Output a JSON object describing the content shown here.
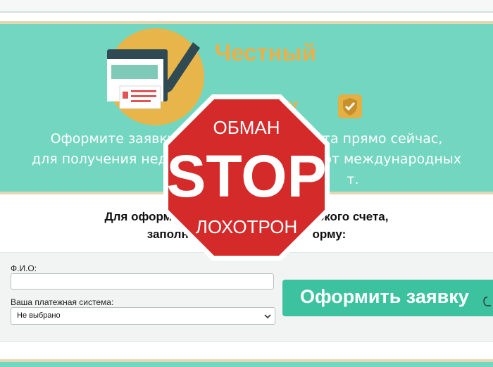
{
  "brand": {
    "name_line1": "Честный",
    "name_line2_visible": "ж",
    "logo_icon": "document-pen-icon",
    "badge_icon": "shield-check-icon"
  },
  "hero": {
    "lines": [
      "Оформите заявку н                          счета прямо сейчас,",
      "для получения недо                              ов от международных",
      "                                                  т."
    ]
  },
  "form": {
    "title_lines": [
      "Для оформления                                 ского счета,",
      "заполни                                   орму:"
    ],
    "name_label": "Ф.И.О:",
    "name_value": "",
    "payment_label": "Ваша платежная система:",
    "payment_selected": "Не выбрано",
    "submit_label": "Оформить заявку"
  },
  "overlay": {
    "icon": "stop-sign-icon",
    "top_text": "ОБМАН",
    "main_text": "STOP",
    "bottom_text": "ЛОХОТРОН"
  },
  "colors": {
    "hero_bg": "#72d6c0",
    "brand": "#e9b04a",
    "submit_bg": "#3cc29e",
    "stop_red": "#d42a2a"
  }
}
